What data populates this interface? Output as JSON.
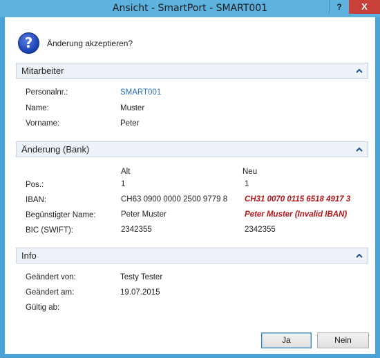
{
  "window": {
    "title": "Ansicht - SmartPort - SMART001",
    "help_label": "?",
    "close_label": "X"
  },
  "prompt": {
    "question": "Änderung akzeptieren?"
  },
  "mitarbeiter": {
    "header": "Mitarbeiter",
    "rows": [
      {
        "label": "Personalnr.:",
        "value": "SMART001"
      },
      {
        "label": "Name:",
        "value": "Muster"
      },
      {
        "label": "Vorname:",
        "value": "Peter"
      }
    ]
  },
  "aenderung": {
    "header": "Änderung (Bank)",
    "col_old": "Alt",
    "col_new": "Neu",
    "rows": [
      {
        "label": "Pos.:",
        "old": "1",
        "new": "1"
      },
      {
        "label": "IBAN:",
        "old": "CH63 0900 0000 2500 9779 8",
        "new": "CH31 0070 0115 6518 4917 3"
      },
      {
        "label": "Begünstigter Name:",
        "old": "Peter Muster",
        "new": "Peter Muster (Invalid IBAN)"
      },
      {
        "label": "BIC (SWIFT):",
        "old": "2342355",
        "new": "2342355"
      }
    ]
  },
  "info": {
    "header": "Info",
    "rows": [
      {
        "label": "Geändert von:",
        "value": "Testy Tester"
      },
      {
        "label": "Geändert am:",
        "value": "19.07.2015"
      },
      {
        "label": "Gültig ab:",
        "value": ""
      }
    ]
  },
  "buttons": {
    "yes": "Ja",
    "no": "Nein"
  },
  "colors": {
    "titlebar": "#5eb2e0",
    "close": "#c7413a",
    "link": "#2a6ebb",
    "changed": "#b3161a"
  }
}
